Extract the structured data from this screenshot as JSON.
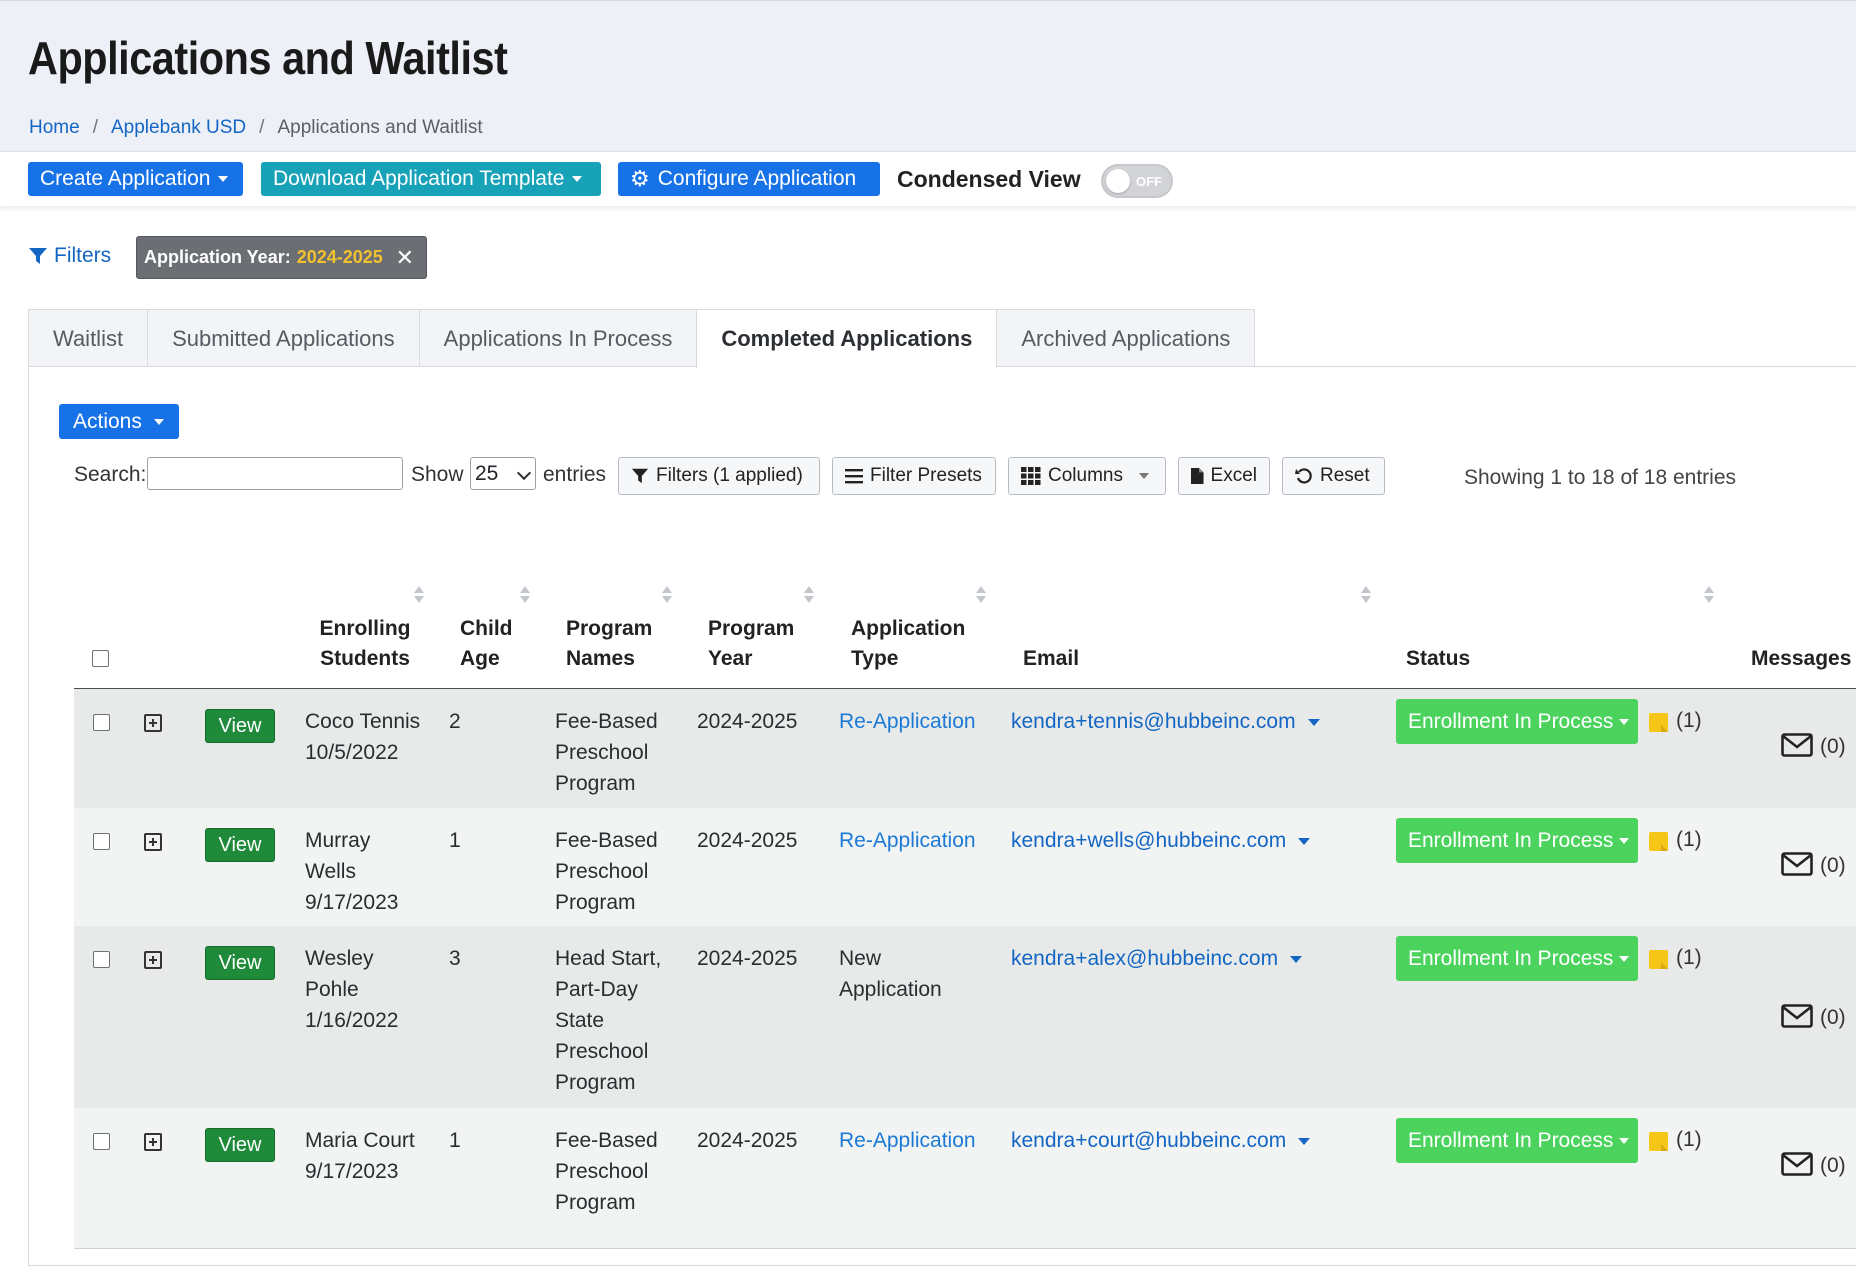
{
  "page": {
    "title": "Applications and Waitlist",
    "breadcrumb": [
      "Home",
      "Applebank USD",
      "Applications and Waitlist"
    ]
  },
  "toolbar": {
    "create_label": "Create Application",
    "download_label": "Download Application Template",
    "configure_label": "Configure Application",
    "condensed_label": "Condensed View",
    "toggle_state": "OFF"
  },
  "filters": {
    "label": "Filters",
    "chip_key": "Application Year:",
    "chip_value": "2024-2025"
  },
  "tabs": [
    {
      "label": "Waitlist",
      "active": false
    },
    {
      "label": "Submitted Applications",
      "active": false
    },
    {
      "label": "Applications In Process",
      "active": false
    },
    {
      "label": "Completed Applications",
      "active": true
    },
    {
      "label": "Archived Applications",
      "active": false
    }
  ],
  "controls": {
    "actions_label": "Actions",
    "search_label": "Search:",
    "search_value": "",
    "show_label": "Show",
    "page_size": "25",
    "entries_label": "entries",
    "filters_btn": "Filters (1 applied)",
    "presets_btn": "Filter Presets",
    "columns_btn": "Columns",
    "excel_btn": "Excel",
    "reset_btn": "Reset",
    "info": "Showing 1 to 18 of 18 entries"
  },
  "table": {
    "headers": {
      "students_1": "Enrolling",
      "students_2": "Students",
      "age_1": "Child",
      "age_2": "Age",
      "program_1": "Program",
      "program_2": "Names",
      "year_1": "Program",
      "year_2": "Year",
      "type_1": "Application",
      "type_2": "Type",
      "email": "Email",
      "status": "Status",
      "messages": "Messages"
    },
    "view_label": "View",
    "rows": [
      {
        "name_lines": [
          "Coco Tennis",
          "10/5/2022"
        ],
        "age": "2",
        "program_lines": [
          "Fee-Based",
          "Preschool",
          "Program"
        ],
        "year": "2024-2025",
        "type_lines": [
          "Re-Application"
        ],
        "type_is_link": true,
        "email": "kendra+tennis@hubbeinc.com",
        "status": "Enrollment In Process",
        "notes": "(1)",
        "messages": "(0)"
      },
      {
        "name_lines": [
          "Murray",
          "Wells",
          "9/17/2023"
        ],
        "age": "1",
        "program_lines": [
          "Fee-Based",
          "Preschool",
          "Program"
        ],
        "year": "2024-2025",
        "type_lines": [
          "Re-Application"
        ],
        "type_is_link": true,
        "email": "kendra+wells@hubbeinc.com",
        "status": "Enrollment In Process",
        "notes": "(1)",
        "messages": "(0)"
      },
      {
        "name_lines": [
          "Wesley",
          "Pohle",
          "1/16/2022"
        ],
        "age": "3",
        "program_lines": [
          "Head Start,",
          "Part-Day",
          "State",
          "Preschool",
          "Program"
        ],
        "year": "2024-2025",
        "type_lines": [
          "New",
          "Application"
        ],
        "type_is_link": false,
        "email": "kendra+alex@hubbeinc.com",
        "status": "Enrollment In Process",
        "notes": "(1)",
        "messages": "(0)"
      },
      {
        "name_lines": [
          "Maria Court",
          "9/17/2023"
        ],
        "age": "1",
        "program_lines": [
          "Fee-Based",
          "Preschool",
          "Program"
        ],
        "year": "2024-2025",
        "type_lines": [
          "Re-Application"
        ],
        "type_is_link": true,
        "email": "kendra+court@hubbeinc.com",
        "status": "Enrollment In Process",
        "notes": "(1)",
        "messages": "(0)"
      }
    ]
  },
  "colors": {
    "primary": "#1772e8",
    "teal": "#17a2b8",
    "success": "#4bd35e",
    "view_green": "#1e8a3a",
    "chip_value": "#f2c12e"
  }
}
